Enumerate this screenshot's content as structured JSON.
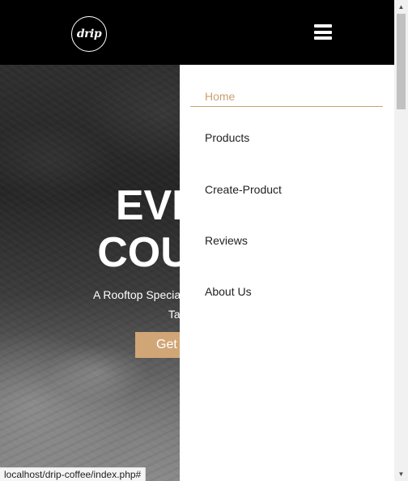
{
  "header": {
    "logo_text": "drip",
    "menu_icon": "hamburger-icon"
  },
  "hero": {
    "title_line1": "EVERY",
    "title_line2": "COUNTS",
    "subtitle_line1": "A Rooftop Specialty Coldbrew Coffee",
    "subtitle_line2": "Tasting",
    "cta_label": "Get Started"
  },
  "menu": {
    "items": [
      {
        "label": "Home",
        "active": true
      },
      {
        "label": "Products",
        "active": false
      },
      {
        "label": "Create-Product",
        "active": false
      },
      {
        "label": "Reviews",
        "active": false
      },
      {
        "label": "About Us",
        "active": false
      }
    ],
    "accent_color": "#c9a171"
  },
  "status_bar": {
    "url": "localhost/drip-coffee/index.php#"
  },
  "colors": {
    "header_bg": "#000000",
    "cta_bg": "#d1a677"
  }
}
